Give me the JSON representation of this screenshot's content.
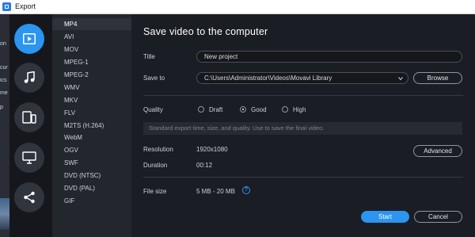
{
  "window": {
    "title": "Export"
  },
  "background_app": {
    "fragments": [
      "ori",
      "cur",
      "ics",
      "me",
      "p"
    ]
  },
  "categories": [
    {
      "name": "video",
      "icon": "play-icon",
      "active": true
    },
    {
      "name": "audio",
      "icon": "music-note-icon",
      "active": false
    },
    {
      "name": "devices",
      "icon": "devices-icon",
      "active": false
    },
    {
      "name": "tv",
      "icon": "monitor-icon",
      "active": false
    },
    {
      "name": "share",
      "icon": "share-icon",
      "active": false
    }
  ],
  "formats": [
    "MP4",
    "AVI",
    "MOV",
    "MPEG-1",
    "MPEG-2",
    "WMV",
    "MKV",
    "FLV",
    "M2TS (H.264)",
    "WebM",
    "OGV",
    "SWF",
    "DVD (NTSC)",
    "DVD (PAL)",
    "GIF"
  ],
  "selected_format": "MP4",
  "main": {
    "heading": "Save video to the computer",
    "title_label": "Title",
    "title_value": "New project",
    "saveto_label": "Save to",
    "saveto_value": "C:\\Users\\Administrator\\Videos\\Movavi Library",
    "browse_label": "Browse",
    "quality_label": "Quality",
    "quality_options": [
      "Draft",
      "Good",
      "High"
    ],
    "quality_selected": "Good",
    "quality_hint": "Standard export time, size, and quality. Use to save the final video.",
    "resolution_label": "Resolution",
    "resolution_value": "1920x1080",
    "advanced_label": "Advanced",
    "duration_label": "Duration",
    "duration_value": "00:12",
    "filesize_label": "File size",
    "filesize_value": "5 MB - 20 MB",
    "help_glyph": "?",
    "start_label": "Start",
    "cancel_label": "Cancel"
  },
  "colors": {
    "accent": "#2b95f0",
    "background": "#1b1d24",
    "format_list": "#23262d",
    "icon_column": "#15171c"
  }
}
